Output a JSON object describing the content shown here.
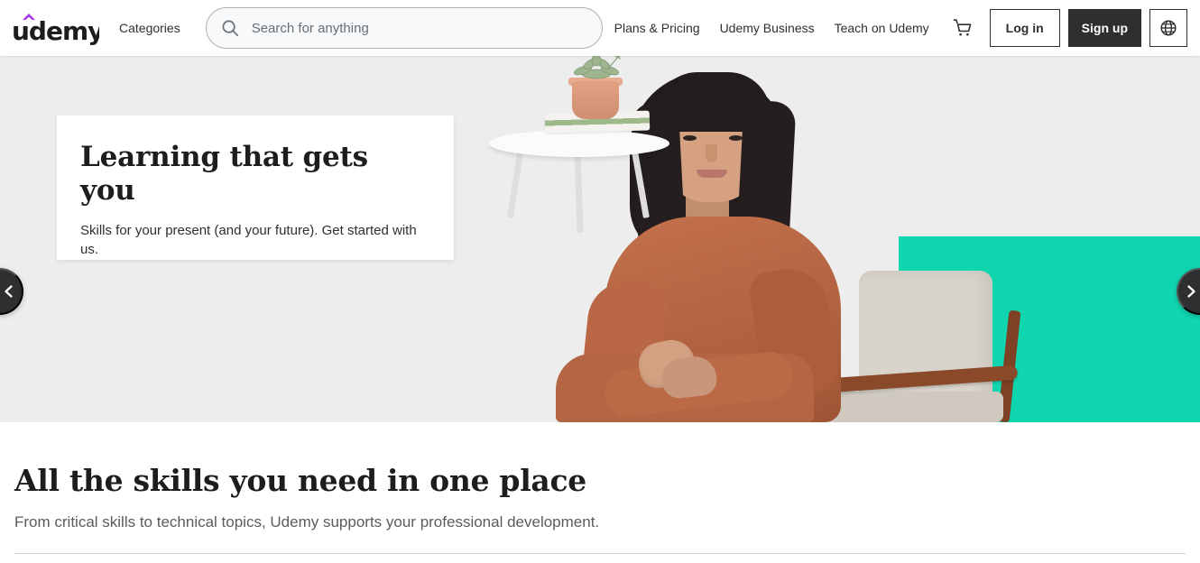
{
  "brand": {
    "name": "udemy",
    "logo_accent_color": "#a435f0",
    "logo_color": "#1c1d1f"
  },
  "header": {
    "categories_label": "Categories",
    "search": {
      "placeholder": "Search for anything",
      "value": "",
      "icon": "search-icon"
    },
    "nav_links": [
      {
        "label": "Plans & Pricing"
      },
      {
        "label": "Udemy Business"
      },
      {
        "label": "Teach on Udemy"
      }
    ],
    "cart_icon": "shopping-cart-icon",
    "login_label": "Log in",
    "signup_label": "Sign up",
    "language_icon": "globe-icon",
    "signup_bg": "#2d2f31"
  },
  "hero": {
    "background_color": "#ededed",
    "accent_block_color": "#10d6b0",
    "card": {
      "title": "Learning that gets you",
      "subtitle": "Skills for your present (and your future). Get started with us."
    },
    "prev_label": "Previous slide",
    "next_label": "Next slide",
    "prev_icon": "chevron-left-icon",
    "next_icon": "chevron-right-icon",
    "image_alt": "Woman in a rust-colored dress sitting in a mid-century armchair beside a white side table with books and a potted succulent"
  },
  "skills": {
    "title": "All the skills you need in one place",
    "subtitle": "From critical skills to technical topics, Udemy supports your professional development."
  }
}
